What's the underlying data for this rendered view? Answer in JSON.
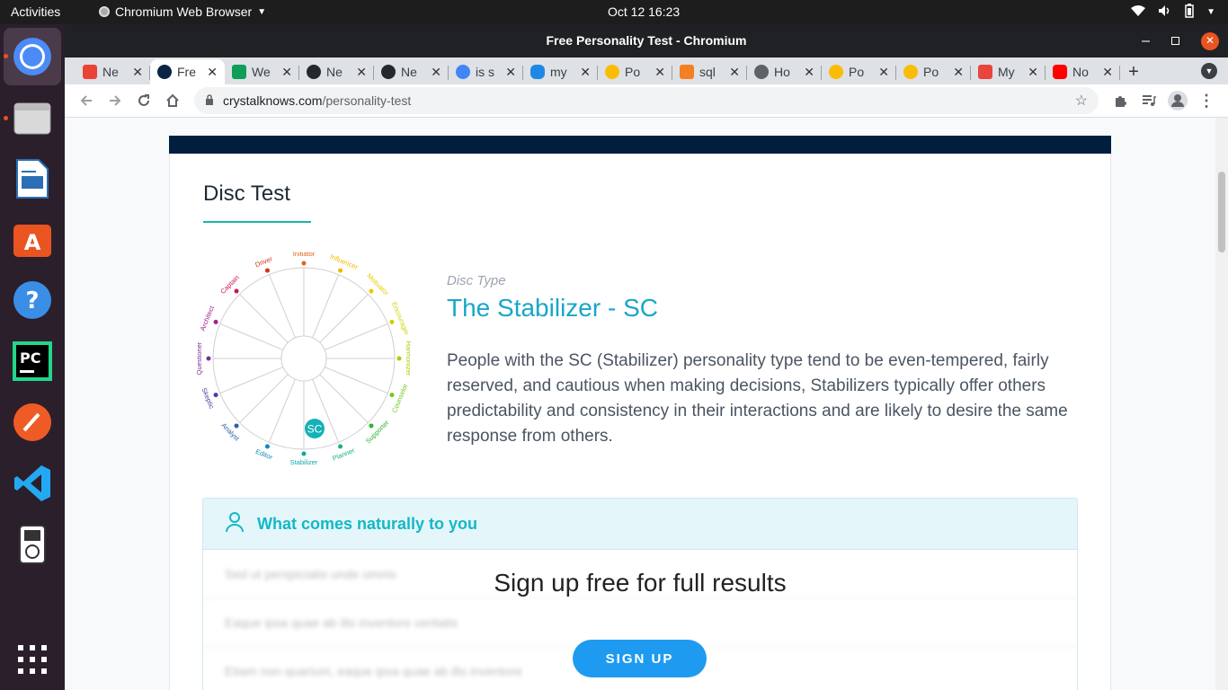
{
  "topbar": {
    "activities": "Activities",
    "app_name": "Chromium Web Browser",
    "clock": "Oct 12  16:23"
  },
  "dock": {
    "items": [
      "chromium-icon",
      "files-icon",
      "writer-icon",
      "app-center-icon",
      "help-icon",
      "pycharm-icon",
      "postman-icon",
      "vscode-icon",
      "media-player-icon",
      "show-apps-icon"
    ]
  },
  "window": {
    "title": "Free Personality Test - Chromium"
  },
  "tabs": [
    {
      "label": "Ne",
      "fav": "#ea4335"
    },
    {
      "label": "Fre",
      "fav": "#0b2545",
      "active": true
    },
    {
      "label": "We",
      "fav": "#0f9d58"
    },
    {
      "label": "Ne",
      "fav": "#24292e"
    },
    {
      "label": "Ne",
      "fav": "#24292e"
    },
    {
      "label": "is s",
      "fav": "#4285f4"
    },
    {
      "label": "my",
      "fav": "#1e88e5"
    },
    {
      "label": "Po",
      "fav": "#fbbc05"
    },
    {
      "label": "sql",
      "fav": "#f48024"
    },
    {
      "label": "Ho",
      "fav": "#5f6368"
    },
    {
      "label": "Po",
      "fav": "#fbbc05"
    },
    {
      "label": "Po",
      "fav": "#fbbc05"
    },
    {
      "label": "My",
      "fav": "#e8453c"
    },
    {
      "label": "No",
      "fav": "#ff0000"
    }
  ],
  "omnibox": {
    "host": "crystalknows.com",
    "path": "/personality-test"
  },
  "page": {
    "section_title": "Disc Test",
    "disc_type_label": "Disc Type",
    "disc_type_name": "The Stabilizer - SC",
    "description": "People with the SC (Stabilizer) personality type tend to be even-tempered, fairly reserved, and cautious when making decisions, Stabilizers typically offer others predictability and consistency in their interactions and are likely to desire the same response from others.",
    "wheel_badge": "SC",
    "wheel_labels": [
      "Initiator",
      "Influencer",
      "Motivator",
      "Encourager",
      "Harmonizer",
      "Counselor",
      "Supporter",
      "Planner",
      "Stabilizer",
      "Editor",
      "Analyst",
      "Skeptic",
      "Questioner",
      "Architect",
      "Captain",
      "Driver"
    ],
    "accordion_title": "What comes naturally to you",
    "accordion_rows": [
      "Sed ut perspiciatis unde omnis",
      "Eaque ipsa quae ab illo inventore veritatis",
      "Etiam non quarium, eaque ipsa quae ab illo inventore"
    ],
    "signup_title": "Sign up free for full results",
    "signup_button": "SIGN UP"
  }
}
